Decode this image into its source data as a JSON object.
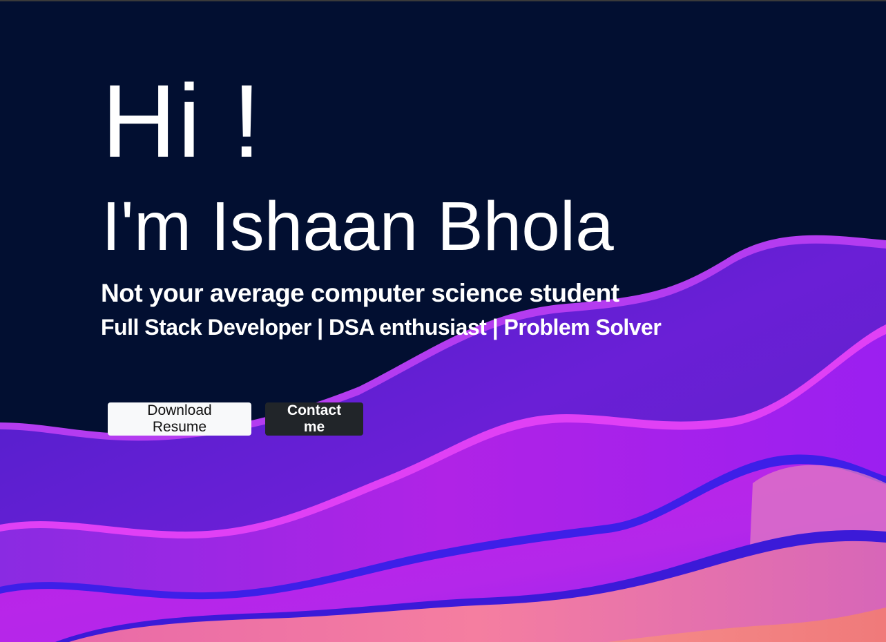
{
  "hero": {
    "greeting": "Hi !",
    "name": "I'm Ishaan Bhola",
    "tagline": "Not your average computer science student",
    "roles": "Full Stack Developer | DSA enthusiast | Problem Solver"
  },
  "buttons": {
    "resume_label": "Download Resume",
    "contact_label": "Contact me"
  },
  "colors": {
    "background": "#020f31",
    "wave_violet": "#6a1fd6",
    "wave_magenta": "#c422e8",
    "wave_pink": "#f37fa6",
    "button_light": "#f8f9fa",
    "button_dark": "#212529"
  }
}
